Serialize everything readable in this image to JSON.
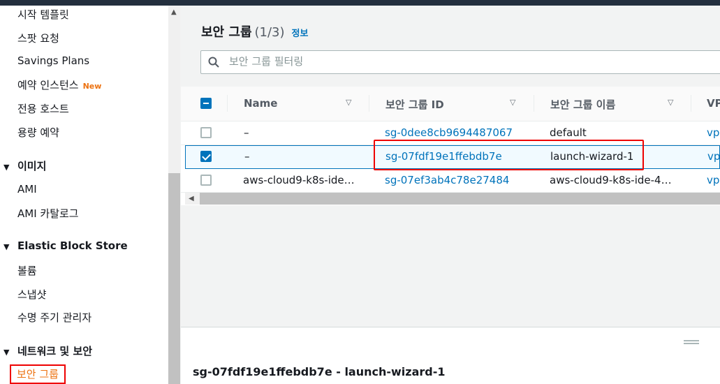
{
  "sidebar": {
    "items": [
      {
        "label": "시작 템플릿"
      },
      {
        "label": "스팟 요청"
      },
      {
        "label": "Savings Plans"
      },
      {
        "label": "예약 인스턴스",
        "badge": "New"
      },
      {
        "label": "전용 호스트"
      },
      {
        "label": "용량 예약"
      }
    ],
    "sections": [
      {
        "label": "이미지",
        "items": [
          "AMI",
          "AMI 카탈로그"
        ]
      },
      {
        "label": "Elastic Block Store",
        "items": [
          "볼륨",
          "스냅샷",
          "수명 주기 관리자"
        ]
      },
      {
        "label": "네트워크 및 보안",
        "items": [
          "보안 그룹"
        ]
      }
    ],
    "toggle_icon": "▼"
  },
  "main": {
    "title": "보안 그룹",
    "count": "(1/3)",
    "info_link": "정보",
    "filter_placeholder": "보안 그룹 필터링",
    "columns": [
      "Name",
      "보안 그룹 ID",
      "보안 그룹 이름",
      "VP"
    ],
    "rows": [
      {
        "name": "–",
        "id": "sg-0dee8cb9694487067",
        "group_name": "default",
        "vpc": "vpc",
        "selected": false
      },
      {
        "name": "–",
        "id": "sg-07fdf19e1ffebdb7e",
        "group_name": "launch-wizard-1",
        "vpc": "vpc",
        "selected": true
      },
      {
        "name": "aws-cloud9-k8s-ide…",
        "id": "sg-07ef3ab4c78e27484",
        "group_name": "aws-cloud9-k8s-ide-4…",
        "vpc": "vpc",
        "selected": false
      }
    ]
  },
  "detail": {
    "title": "sg-07fdf19e1ffebdb7e - launch-wizard-1"
  },
  "colors": {
    "accent": "#0073bb",
    "highlight": "#ee0000",
    "active_nav": "#ec7211",
    "topbar": "#232f3e"
  }
}
